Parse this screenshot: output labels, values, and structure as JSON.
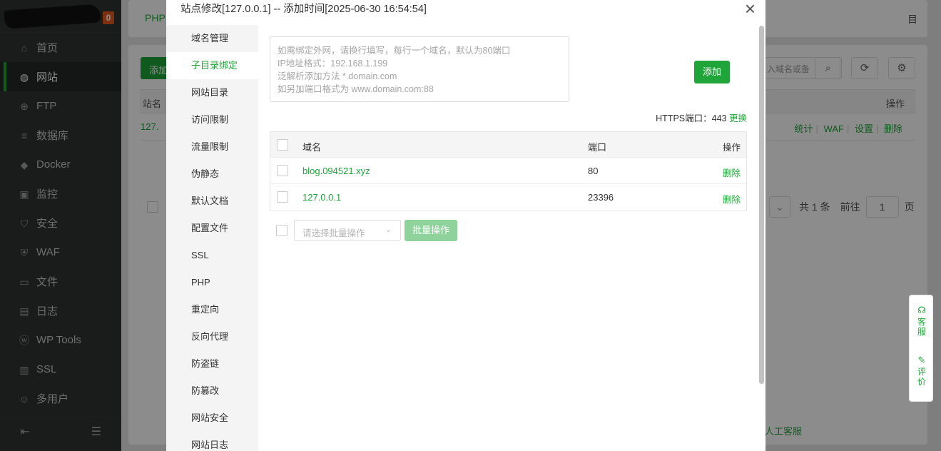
{
  "sidebar": {
    "badge": "0",
    "items": [
      {
        "label": "首页",
        "icon": "home-icon",
        "glyph": "⌂"
      },
      {
        "label": "网站",
        "icon": "globe-icon",
        "glyph": "◍"
      },
      {
        "label": "FTP",
        "icon": "ftp-icon",
        "glyph": "⊕"
      },
      {
        "label": "数据库",
        "icon": "database-icon",
        "glyph": "≡"
      },
      {
        "label": "Docker",
        "icon": "docker-icon",
        "glyph": "◆"
      },
      {
        "label": "监控",
        "icon": "monitor-icon",
        "glyph": "▣"
      },
      {
        "label": "安全",
        "icon": "shield-icon",
        "glyph": "⛉"
      },
      {
        "label": "WAF",
        "icon": "waf-icon",
        "glyph": "⛨"
      },
      {
        "label": "文件",
        "icon": "folder-icon",
        "glyph": "▭"
      },
      {
        "label": "日志",
        "icon": "log-icon",
        "glyph": "▤"
      },
      {
        "label": "WP Tools",
        "icon": "wordpress-icon",
        "glyph": "ⓦ"
      },
      {
        "label": "SSL",
        "icon": "ssl-icon",
        "glyph": "▥"
      },
      {
        "label": "多用户",
        "icon": "users-icon",
        "glyph": "☺"
      }
    ],
    "active_index": 1
  },
  "background": {
    "tab_left": "PHP",
    "tab_right": "目",
    "add_button": "添加",
    "search_placeholder": "入域名或备",
    "table_head_left": "站名",
    "table_head_right": "操作",
    "row_site": "127.",
    "row_links": [
      "统计",
      "WAF",
      "设置",
      "删除"
    ],
    "pager": {
      "total": "共 1 条",
      "goto": "前往",
      "page": "1",
      "page_suffix": "页"
    },
    "float_service": "客服",
    "float_review": "评价",
    "kefu": "人工客服"
  },
  "modal": {
    "title": "站点修改[127.0.0.1] -- 添加时间[2025-06-30 16:54:54]",
    "close": "×",
    "menu": [
      "域名管理",
      "子目录绑定",
      "网站目录",
      "访问限制",
      "流量限制",
      "伪静态",
      "默认文档",
      "配置文件",
      "SSL",
      "PHP",
      "重定向",
      "反向代理",
      "防盗链",
      "防篡改",
      "网站安全",
      "网站日志"
    ],
    "menu_active": 1,
    "textarea_placeholder_lines": [
      "如需绑定外网，请换行填写，每行一个域名，默认为80端口",
      "IP地址格式：192.168.1.199",
      "泛解析添加方法 *.domain.com",
      "如另加端口格式为 www.domain.com:88"
    ],
    "add_button": "添加",
    "https_label": "HTTPS端口：443",
    "https_change": "更换",
    "table": {
      "headers": {
        "domain": "域名",
        "port": "端口",
        "op": "操作"
      },
      "rows": [
        {
          "domain": "blog.094521.xyz",
          "port": "80",
          "op": "删除"
        },
        {
          "domain": "127.0.0.1",
          "port": "23396",
          "op": "删除"
        }
      ]
    },
    "batch_select_placeholder": "请选择批量操作",
    "batch_button": "批量操作"
  }
}
